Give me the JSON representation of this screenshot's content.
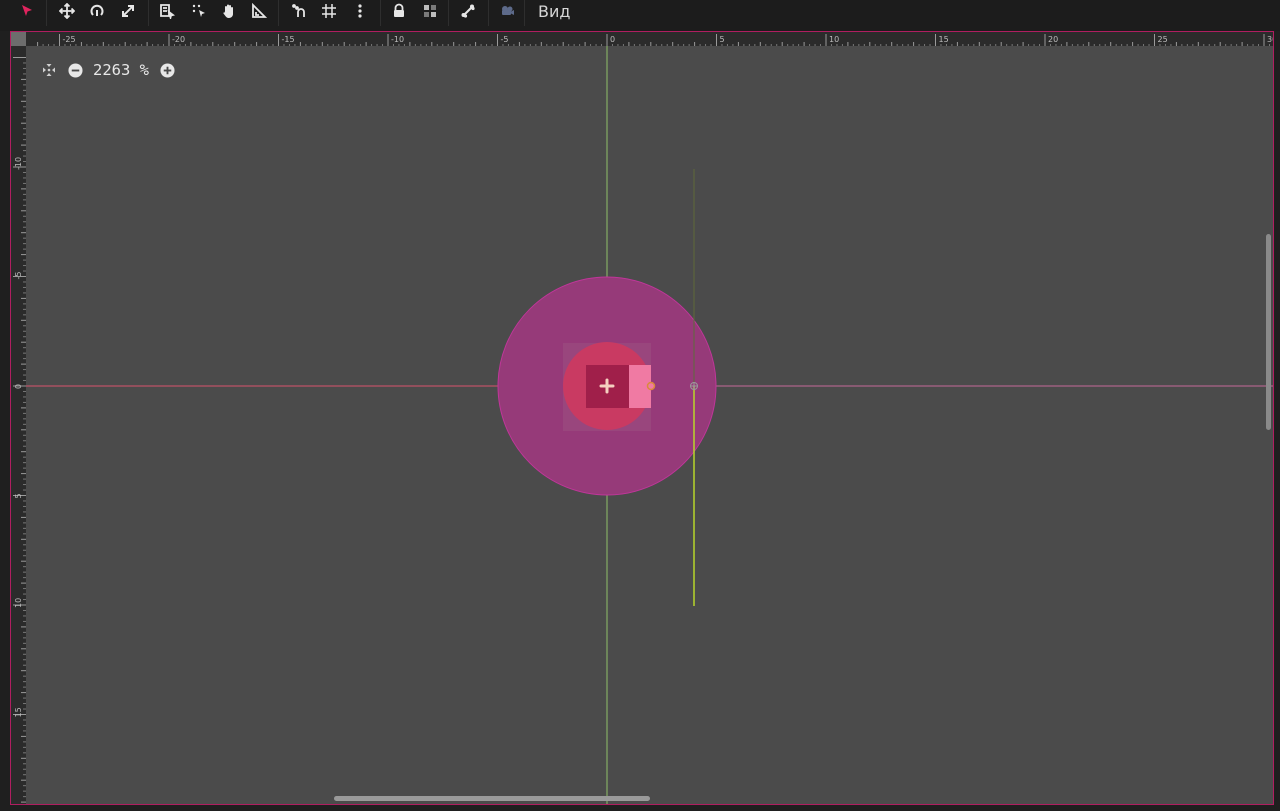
{
  "toolbar": {
    "tools": [
      {
        "name": "select-tool-icon",
        "active": true
      },
      {
        "name": "move-tool-icon"
      },
      {
        "name": "rotate-tool-icon"
      },
      {
        "name": "scale-tool-icon"
      },
      {
        "name": "list-select-tool-icon"
      },
      {
        "name": "pivot-tool-icon"
      },
      {
        "name": "pan-tool-icon"
      },
      {
        "name": "ruler-tool-icon"
      },
      {
        "name": "smart-snap-icon"
      },
      {
        "name": "grid-snap-icon"
      },
      {
        "name": "snap-options-icon"
      },
      {
        "name": "lock-icon"
      },
      {
        "name": "group-icon"
      },
      {
        "name": "bone-icon"
      },
      {
        "name": "camera-icon"
      }
    ],
    "view_menu_label": "Вид"
  },
  "viewport": {
    "zoom_out_icon": "minus-circle-icon",
    "zoom_in_icon": "plus-circle-icon",
    "center_view_icon": "center-view-icon",
    "zoom_value": "2263 %"
  },
  "rulers": {
    "top_labels": [
      "-25",
      "-20",
      "-15",
      "-10",
      "-5",
      "0",
      "5",
      "10",
      "15",
      "20",
      "25",
      "30"
    ],
    "left_labels": [
      "-10",
      "-5",
      "0",
      "5",
      "10",
      "15"
    ]
  },
  "colors": {
    "accent": "#e0245e",
    "viewport_bg": "#4b4b4b",
    "outer_circle": "#963a79",
    "inner_circle": "#c93a62",
    "x_axis": "#d8536c",
    "y_axis": "#8fbf6a",
    "frame_border": "#b01e60"
  }
}
